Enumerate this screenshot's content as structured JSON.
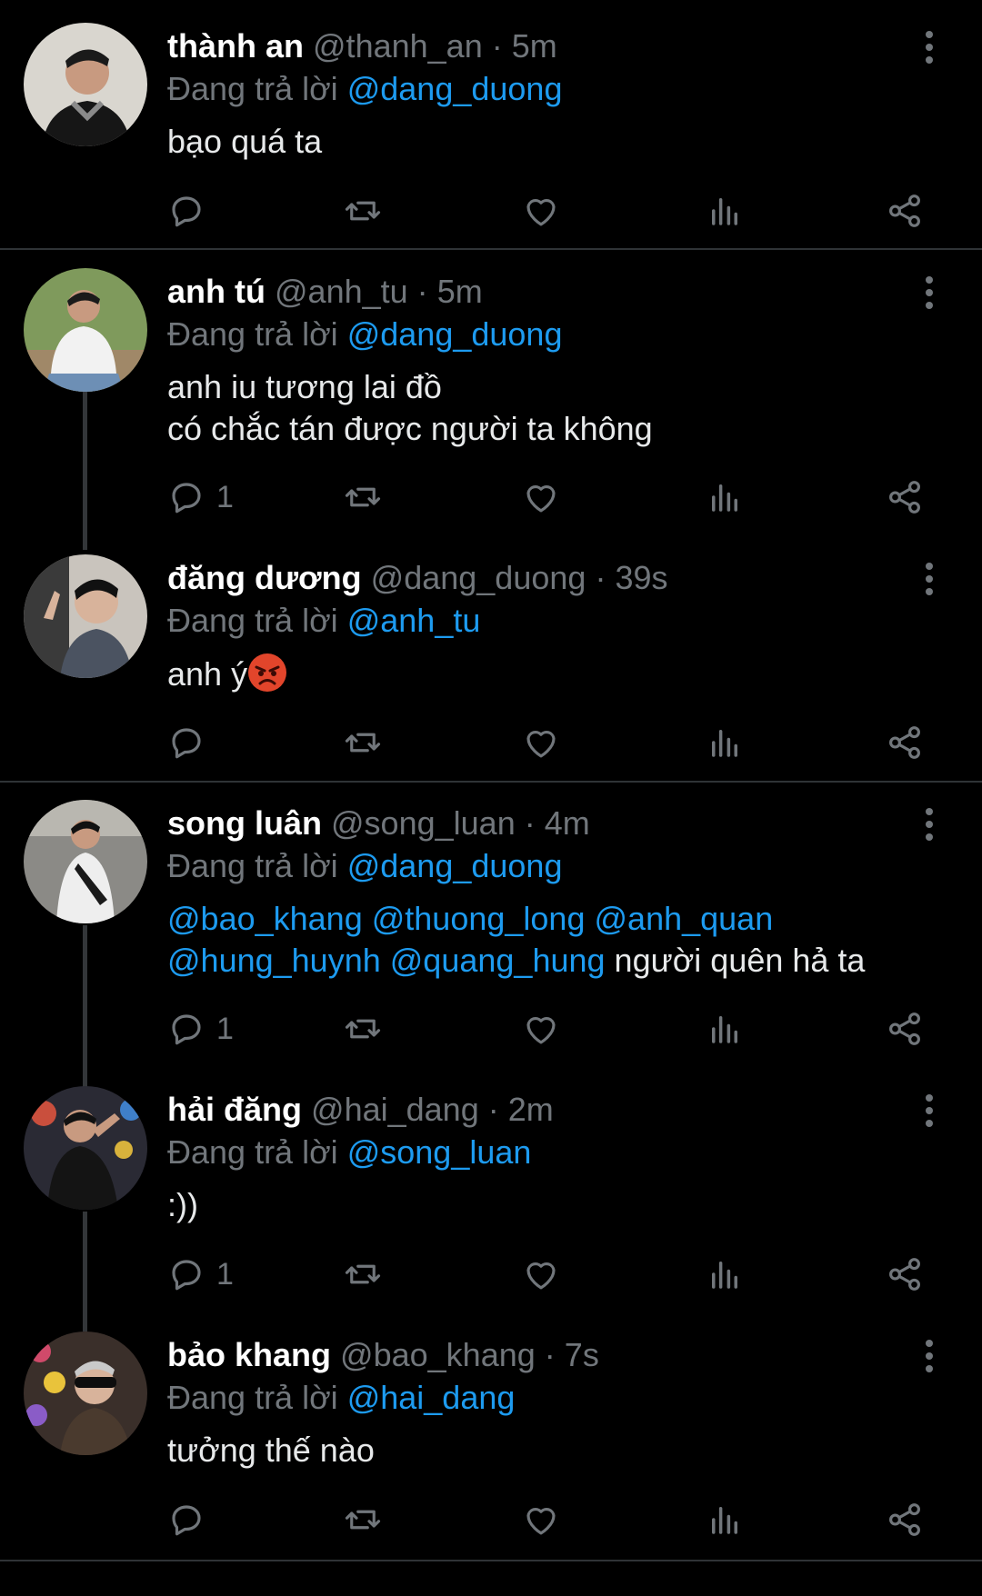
{
  "reply_prefix": "Đang trả lời",
  "tweets": [
    {
      "name": "thành an",
      "handle": "@thanh_an",
      "sep": "·",
      "time": "5m",
      "reply_to": "@dang_duong",
      "line1": "bạo quá ta",
      "reply_count": ""
    },
    {
      "name": "anh tú",
      "handle": "@anh_tu",
      "sep": "·",
      "time": "5m",
      "reply_to": "@dang_duong",
      "line1": "anh iu tương lai đồ",
      "line2": "có chắc tán được người ta không",
      "reply_count": "1"
    },
    {
      "name": "đăng dương",
      "handle": "@dang_duong",
      "sep": "·",
      "time": "39s",
      "reply_to": "@anh_tu",
      "line1": "anh ý",
      "reply_count": ""
    },
    {
      "name": "song luân",
      "handle": "@song_luan",
      "sep": "·",
      "time": "4m",
      "reply_to": "@dang_duong",
      "mentions1": [
        "@bao_khang",
        "@thuong_long",
        "@anh_quan"
      ],
      "mentions2": [
        "@hung_huynh",
        "@quang_hung"
      ],
      "line2_text": "người quên hả ta",
      "reply_count": "1"
    },
    {
      "name": "hải đăng",
      "handle": "@hai_dang",
      "sep": "·",
      "time": "2m",
      "reply_to": "@song_luan",
      "line1": ":))",
      "reply_count": "1"
    },
    {
      "name": "bảo khang",
      "handle": "@bao_khang",
      "sep": "·",
      "time": "7s",
      "reply_to": "@hai_dang",
      "line1": "tưởng thế nào",
      "reply_count": ""
    }
  ],
  "icons": {
    "reply": "reply-icon",
    "retweet": "retweet-icon",
    "like": "heart-icon",
    "views": "views-icon",
    "share": "share-icon",
    "more": "more-vertical-icon",
    "emoji": "angry-face-emoji"
  },
  "colors": {
    "background": "#000000",
    "accent": "#1d9bf0",
    "muted": "#71767b",
    "text": "#e7e9ea",
    "divider": "#2f3336"
  }
}
